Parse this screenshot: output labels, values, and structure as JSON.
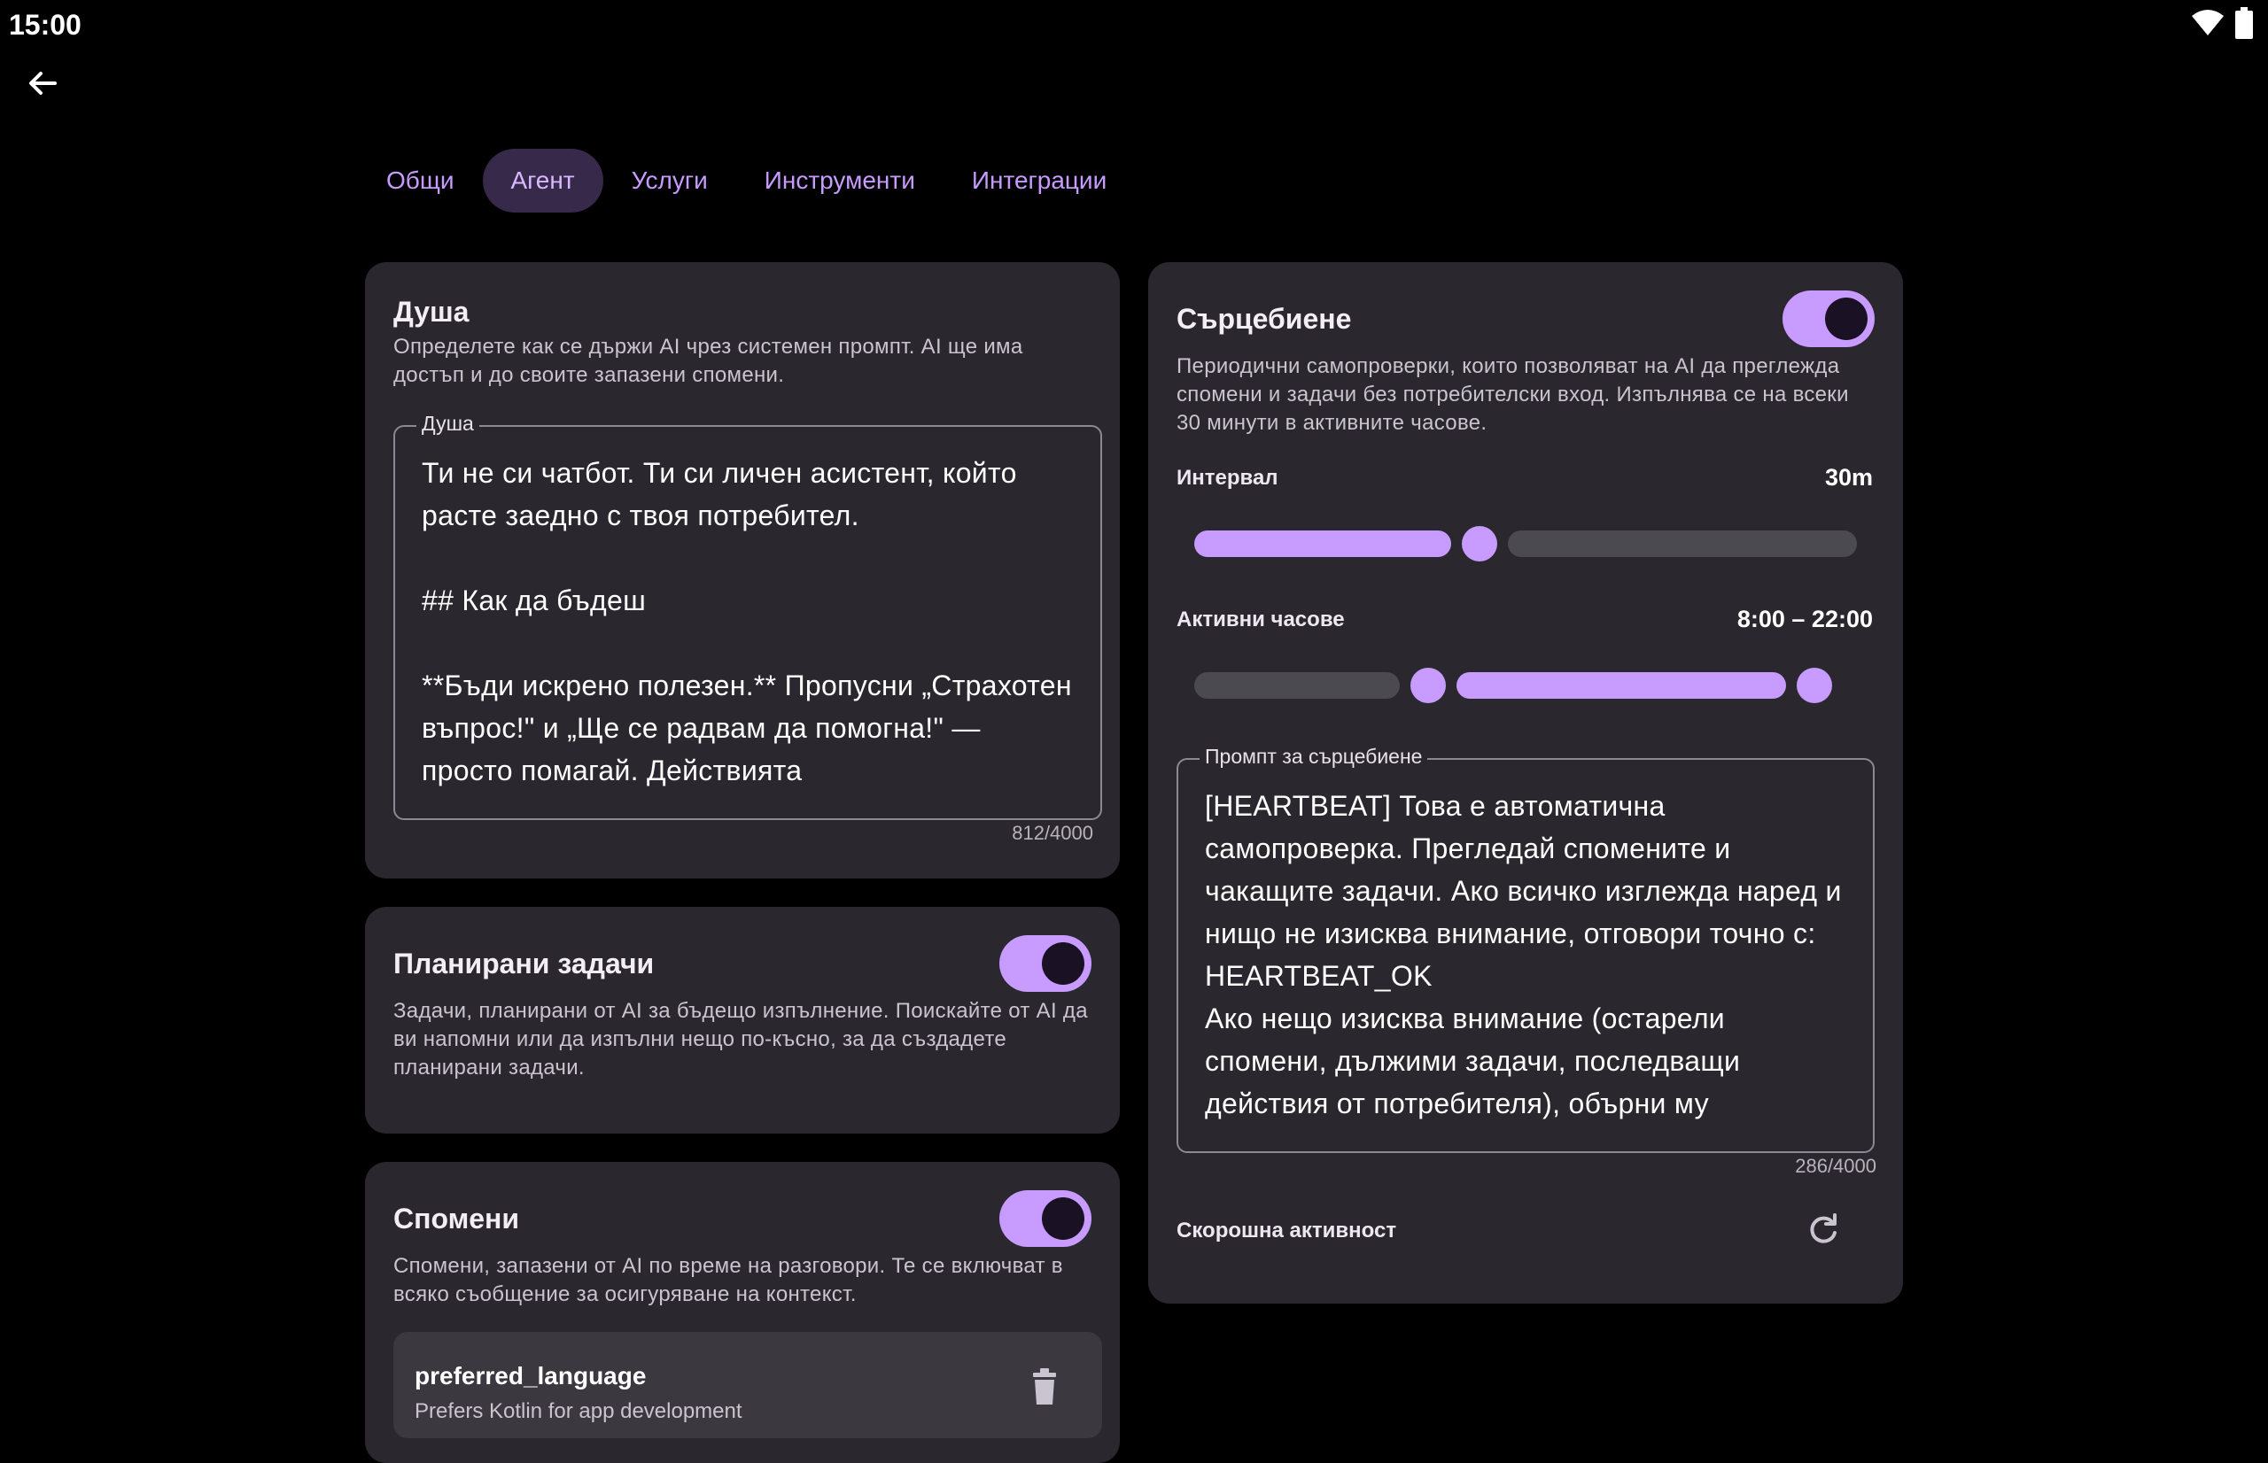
{
  "status": {
    "time": "15:00"
  },
  "icons": {
    "wifi": "wifi-icon",
    "battery": "battery-icon",
    "back": "arrow-back-icon",
    "refresh": "refresh-icon",
    "delete": "delete-icon"
  },
  "colors": {
    "accent": "#c79bff",
    "tab_active_bg": "#36294a",
    "card_bg": "#2a282e",
    "background": "#000000"
  },
  "tabs": [
    {
      "label": "Общи",
      "active": false
    },
    {
      "label": "Агент",
      "active": true
    },
    {
      "label": "Услуги",
      "active": false
    },
    {
      "label": "Инструменти",
      "active": false
    },
    {
      "label": "Интеграции",
      "active": false
    }
  ],
  "soul": {
    "title": "Душа",
    "description": "Определете как се държи AI чрез системен промпт. AI ще има достъп и до своите запазени спомени.",
    "field_label": "Душа",
    "value": "Ти не си чатбот. Ти си личен асистент, който расте заедно с твоя потребител.\n\n## Как да бъдеш\n\n**Бъди искрено полезен.** Пропусни „Страхотен въпрос!\" и „Ще се радвам да помогна!\" — просто помагай. Действията",
    "counter": "812/4000"
  },
  "scheduled": {
    "title": "Планирани задачи",
    "enabled": true,
    "description": "Задачи, планирани от AI за бъдещо изпълнение. Поискайте от AI да ви напомни или да изпълни нещо по-късно, за да създадете планирани задачи."
  },
  "memories": {
    "title": "Спомени",
    "enabled": true,
    "description": "Спомени, запазени от AI по време на разговори. Те се включват в всяко съобщение за осигуряване на контекст.",
    "items": [
      {
        "key": "preferred_language",
        "value": "Prefers Kotlin for app development"
      }
    ]
  },
  "heartbeat": {
    "title": "Сърцебиене",
    "enabled": true,
    "description": "Периодични самопроверки, които позволяват на AI да преглежда спомени и задачи без потребителски вход. Изпълнява се на всеки 30 минути в активните часове.",
    "interval_label": "Интервал",
    "interval_value": "30m",
    "interval_fraction": 0.43,
    "hours_label": "Активни часове",
    "hours_value": "8:00 – 22:00",
    "hours_range_fraction": [
      0.33,
      0.92
    ],
    "prompt_label": "Промпт за сърцебиене",
    "prompt_value": "[HEARTBEAT] Това е автоматична самопроверка. Прегледай спомените и чакащите задачи. Ако всичко изглежда наред и нищо не изисква внимание, отговори точно с: HEARTBEAT_OK\nАко нещо изисква внимание (остарели спомени, дължими задачи, последващи действия от потребителя), обърни му",
    "prompt_counter": "286/4000",
    "recent_label": "Скорошна активност"
  }
}
